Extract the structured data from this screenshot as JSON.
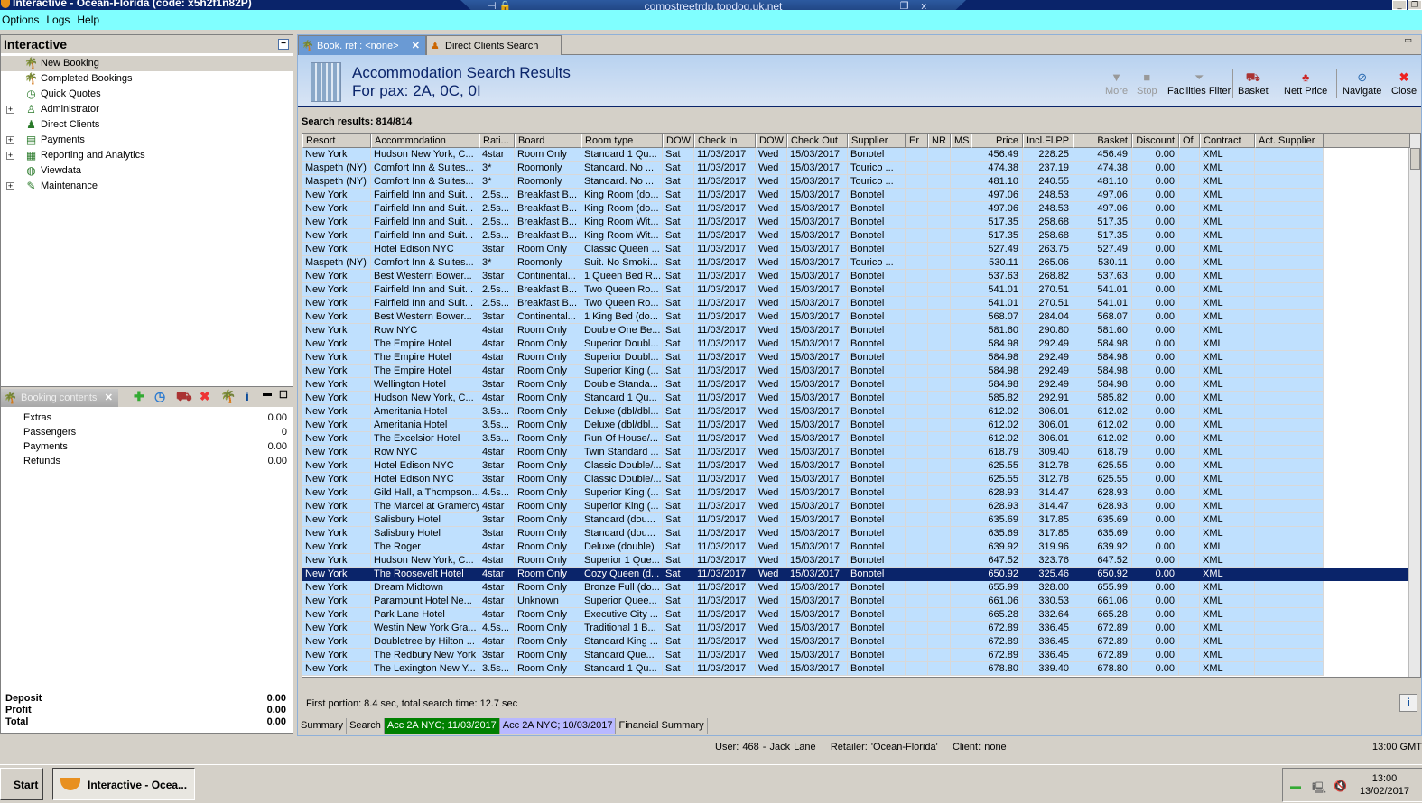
{
  "window": {
    "title": "Interactive - Ocean-Florida (code: x5h2f1n82P)"
  },
  "rdp": {
    "host": "comostreetrdp.topdog.uk.net"
  },
  "menu": [
    "Options",
    "Logs",
    "Help"
  ],
  "left_panel": {
    "title": "Interactive",
    "items": [
      {
        "label": "New Booking",
        "icon": "palm-tree-icon",
        "expandable": false
      },
      {
        "label": "Completed Bookings",
        "icon": "palm-tree-money-icon",
        "expandable": false
      },
      {
        "label": "Quick Quotes",
        "icon": "clock-icon",
        "expandable": false
      },
      {
        "label": "Administrator",
        "icon": "admin-icon",
        "expandable": true
      },
      {
        "label": "Direct Clients",
        "icon": "person-icon",
        "expandable": false
      },
      {
        "label": "Payments",
        "icon": "payments-icon",
        "expandable": true
      },
      {
        "label": "Reporting and Analytics",
        "icon": "report-icon",
        "expandable": true
      },
      {
        "label": "Viewdata",
        "icon": "globe-icon",
        "expandable": false
      },
      {
        "label": "Maintenance",
        "icon": "tools-icon",
        "expandable": true
      }
    ]
  },
  "booking_contents": {
    "tab": "Booking contents",
    "rows": [
      {
        "label": "Extras",
        "value": "0.00"
      },
      {
        "label": "Passengers",
        "value": "0"
      },
      {
        "label": "Payments",
        "value": "0.00"
      },
      {
        "label": "Refunds",
        "value": "0.00"
      }
    ],
    "totals": [
      {
        "label": "Deposit",
        "value": "0.00"
      },
      {
        "label": "Profit",
        "value": "0.00"
      },
      {
        "label": "Total",
        "value": "0.00"
      }
    ]
  },
  "tabs": [
    {
      "label": "Book. ref.: <none>"
    },
    {
      "label": "Direct Clients Search"
    }
  ],
  "header": {
    "title": "Accommodation Search Results",
    "subtitle": "For pax: 2A, 0C, 0I"
  },
  "toolbar": {
    "more": "More",
    "stop": "Stop",
    "facilities": "Facilities Filter",
    "basket": "Basket",
    "nett": "Nett Price",
    "navigate": "Navigate",
    "close": "Close"
  },
  "results_count": "Search results: 814/814",
  "columns": [
    "Resort",
    "Accommodation",
    "Rati...",
    "Board",
    "Room type",
    "DOW",
    "Check In",
    "DOW",
    "Check Out",
    "Supplier",
    "Er",
    "NR",
    "MS",
    "Price",
    "Incl.Fl.PP",
    "Basket",
    "Discount",
    "Of",
    "Contract",
    "Act. Supplier"
  ],
  "common": {
    "dow_in": "Sat",
    "check_in": "11/03/2017",
    "dow_out": "Wed",
    "check_out": "15/03/2017",
    "discount": "0.00",
    "contract": "XML"
  },
  "selected_row": 31,
  "rows": [
    [
      "New York",
      "Hudson New York, C...",
      "4star",
      "Room Only",
      "Standard 1 Qu...",
      "Bonotel",
      "456.49",
      "228.25",
      "456.49"
    ],
    [
      "Maspeth (NY)",
      "Comfort Inn & Suites...",
      "3*",
      "Roomonly",
      "Standard. No ...",
      "Tourico ...",
      "474.38",
      "237.19",
      "474.38"
    ],
    [
      "Maspeth (NY)",
      "Comfort Inn & Suites...",
      "3*",
      "Roomonly",
      "Standard. No ...",
      "Tourico ...",
      "481.10",
      "240.55",
      "481.10"
    ],
    [
      "New York",
      "Fairfield Inn and Suit...",
      "2.5s...",
      "Breakfast B...",
      "King Room (do...",
      "Bonotel",
      "497.06",
      "248.53",
      "497.06"
    ],
    [
      "New York",
      "Fairfield Inn and Suit...",
      "2.5s...",
      "Breakfast B...",
      "King Room (do...",
      "Bonotel",
      "497.06",
      "248.53",
      "497.06"
    ],
    [
      "New York",
      "Fairfield Inn and Suit...",
      "2.5s...",
      "Breakfast B...",
      "King Room Wit...",
      "Bonotel",
      "517.35",
      "258.68",
      "517.35"
    ],
    [
      "New York",
      "Fairfield Inn and Suit...",
      "2.5s...",
      "Breakfast B...",
      "King Room Wit...",
      "Bonotel",
      "517.35",
      "258.68",
      "517.35"
    ],
    [
      "New York",
      "Hotel Edison NYC",
      "3star",
      "Room Only",
      "Classic Queen ...",
      "Bonotel",
      "527.49",
      "263.75",
      "527.49"
    ],
    [
      "Maspeth (NY)",
      "Comfort Inn & Suites...",
      "3*",
      "Roomonly",
      "Suit. No Smoki...",
      "Tourico ...",
      "530.11",
      "265.06",
      "530.11"
    ],
    [
      "New York",
      "Best Western Bower...",
      "3star",
      "Continental...",
      "1 Queen Bed R...",
      "Bonotel",
      "537.63",
      "268.82",
      "537.63"
    ],
    [
      "New York",
      "Fairfield Inn and Suit...",
      "2.5s...",
      "Breakfast B...",
      "Two Queen Ro...",
      "Bonotel",
      "541.01",
      "270.51",
      "541.01"
    ],
    [
      "New York",
      "Fairfield Inn and Suit...",
      "2.5s...",
      "Breakfast B...",
      "Two Queen Ro...",
      "Bonotel",
      "541.01",
      "270.51",
      "541.01"
    ],
    [
      "New York",
      "Best Western Bower...",
      "3star",
      "Continental...",
      "1 King Bed (do...",
      "Bonotel",
      "568.07",
      "284.04",
      "568.07"
    ],
    [
      "New York",
      "Row NYC",
      "4star",
      "Room Only",
      "Double One Be...",
      "Bonotel",
      "581.60",
      "290.80",
      "581.60"
    ],
    [
      "New York",
      "The Empire Hotel",
      "4star",
      "Room Only",
      "Superior Doubl...",
      "Bonotel",
      "584.98",
      "292.49",
      "584.98"
    ],
    [
      "New York",
      "The Empire Hotel",
      "4star",
      "Room Only",
      "Superior Doubl...",
      "Bonotel",
      "584.98",
      "292.49",
      "584.98"
    ],
    [
      "New York",
      "The Empire Hotel",
      "4star",
      "Room Only",
      "Superior King (...",
      "Bonotel",
      "584.98",
      "292.49",
      "584.98"
    ],
    [
      "New York",
      "Wellington Hotel",
      "3star",
      "Room Only",
      "Double Standa...",
      "Bonotel",
      "584.98",
      "292.49",
      "584.98"
    ],
    [
      "New York",
      "Hudson New York, C...",
      "4star",
      "Room Only",
      "Standard 1 Qu...",
      "Bonotel",
      "585.82",
      "292.91",
      "585.82"
    ],
    [
      "New York",
      "Ameritania Hotel",
      "3.5s...",
      "Room Only",
      "Deluxe (dbl/dbl...",
      "Bonotel",
      "612.02",
      "306.01",
      "612.02"
    ],
    [
      "New York",
      "Ameritania Hotel",
      "3.5s...",
      "Room Only",
      "Deluxe (dbl/dbl...",
      "Bonotel",
      "612.02",
      "306.01",
      "612.02"
    ],
    [
      "New York",
      "The Excelsior Hotel",
      "3.5s...",
      "Room Only",
      "Run Of House/...",
      "Bonotel",
      "612.02",
      "306.01",
      "612.02"
    ],
    [
      "New York",
      "Row NYC",
      "4star",
      "Room Only",
      "Twin Standard ...",
      "Bonotel",
      "618.79",
      "309.40",
      "618.79"
    ],
    [
      "New York",
      "Hotel Edison NYC",
      "3star",
      "Room Only",
      "Classic Double/...",
      "Bonotel",
      "625.55",
      "312.78",
      "625.55"
    ],
    [
      "New York",
      "Hotel Edison NYC",
      "3star",
      "Room Only",
      "Classic Double/...",
      "Bonotel",
      "625.55",
      "312.78",
      "625.55"
    ],
    [
      "New York",
      "Gild Hall, a Thompson...",
      "4.5s...",
      "Room Only",
      "Superior King (...",
      "Bonotel",
      "628.93",
      "314.47",
      "628.93"
    ],
    [
      "New York",
      "The Marcel at Gramercy",
      "4star",
      "Room Only",
      "Superior King (...",
      "Bonotel",
      "628.93",
      "314.47",
      "628.93"
    ],
    [
      "New York",
      "Salisbury Hotel",
      "3star",
      "Room Only",
      "Standard (dou...",
      "Bonotel",
      "635.69",
      "317.85",
      "635.69"
    ],
    [
      "New York",
      "Salisbury Hotel",
      "3star",
      "Room Only",
      "Standard (dou...",
      "Bonotel",
      "635.69",
      "317.85",
      "635.69"
    ],
    [
      "New York",
      "The Roger",
      "4star",
      "Room Only",
      "Deluxe (double)",
      "Bonotel",
      "639.92",
      "319.96",
      "639.92"
    ],
    [
      "New York",
      "Hudson New York, C...",
      "4star",
      "Room Only",
      "Superior 1 Que...",
      "Bonotel",
      "647.52",
      "323.76",
      "647.52"
    ],
    [
      "New York",
      "The Roosevelt Hotel",
      "4star",
      "Room Only",
      "Cozy Queen (d...",
      "Bonotel",
      "650.92",
      "325.46",
      "650.92"
    ],
    [
      "New York",
      "Dream Midtown",
      "4star",
      "Room Only",
      "Bronze Full (do...",
      "Bonotel",
      "655.99",
      "328.00",
      "655.99"
    ],
    [
      "New York",
      "Paramount Hotel Ne...",
      "4star",
      "Unknown",
      "Superior Quee...",
      "Bonotel",
      "661.06",
      "330.53",
      "661.06"
    ],
    [
      "New York",
      "Park Lane Hotel",
      "4star",
      "Room Only",
      "Executive City ...",
      "Bonotel",
      "665.28",
      "332.64",
      "665.28"
    ],
    [
      "New York",
      "Westin New York Gra...",
      "4.5s...",
      "Room Only",
      "Traditional 1 B...",
      "Bonotel",
      "672.89",
      "336.45",
      "672.89"
    ],
    [
      "New York",
      "Doubletree by Hilton ...",
      "4star",
      "Room Only",
      "Standard King ...",
      "Bonotel",
      "672.89",
      "336.45",
      "672.89"
    ],
    [
      "New York",
      "The Redbury New York",
      "3star",
      "Room Only",
      "Standard Que...",
      "Bonotel",
      "672.89",
      "336.45",
      "672.89"
    ],
    [
      "New York",
      "The Lexington New Y...",
      "3.5s...",
      "Room Only",
      "Standard 1 Qu...",
      "Bonotel",
      "678.80",
      "339.40",
      "678.80"
    ]
  ],
  "status_text": "First portion: 8.4 sec, total search time: 12.7 sec",
  "bottom_tabs": [
    {
      "label": "Summary",
      "color": "#d4d0c8"
    },
    {
      "label": "Search",
      "color": "#d4d0c8"
    },
    {
      "label": "Acc 2A NYC; 11/03/2017",
      "color": "#008000"
    },
    {
      "label": "Acc 2A NYC; 10/03/2017",
      "color": "#b8b8ff"
    },
    {
      "label": "Financial Summary",
      "color": "#d4d0c8"
    }
  ],
  "statusbar": {
    "user": "User: 468 - Jack Lane    Retailer: 'Ocean-Florida'    Client: none",
    "time": "13:00 GMT"
  },
  "taskbar": {
    "start": "Start",
    "task": "Interactive - Ocea...",
    "clock_time": "13:00",
    "clock_date": "13/02/2017"
  }
}
